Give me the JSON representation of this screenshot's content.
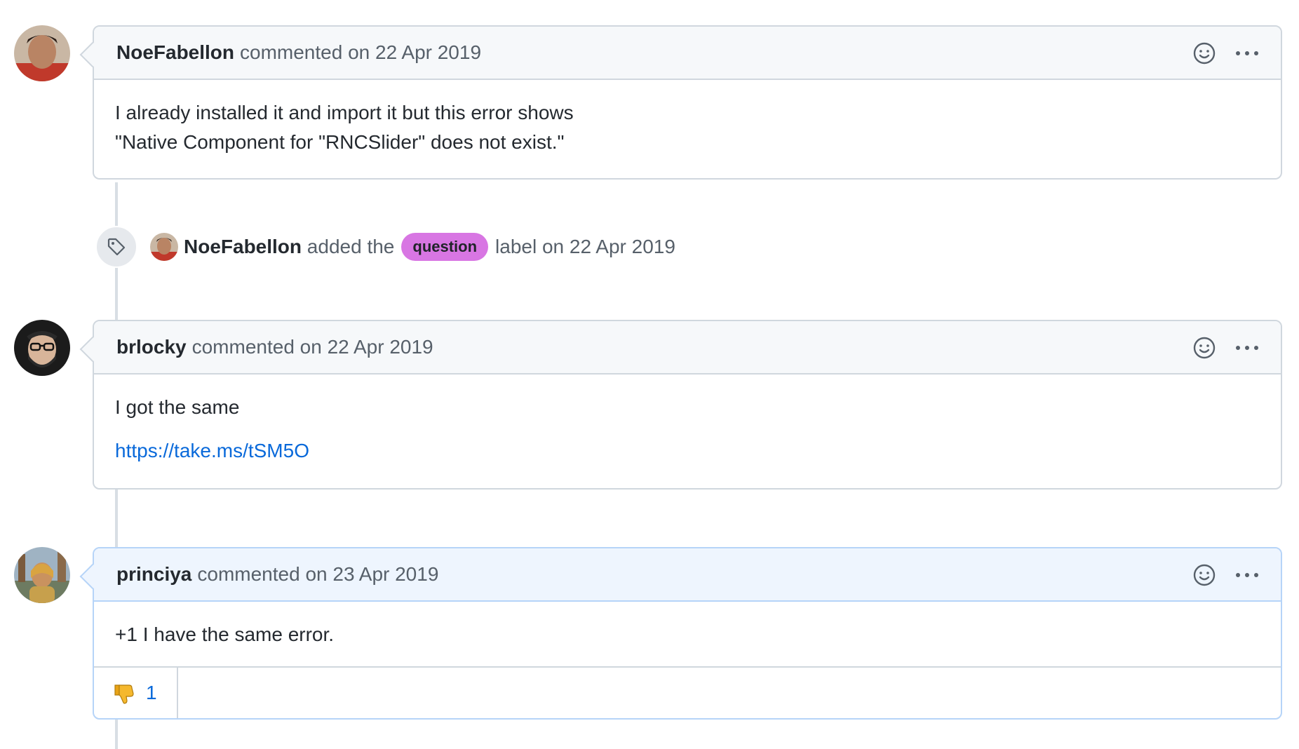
{
  "timeline": {
    "comments": [
      {
        "author": "NoeFabellon",
        "meta": "commented on 22 Apr 2019",
        "body_lines": [
          "I already installed it and import it but this error shows",
          "\"Native Component for \"RNCSlider\" does not exist.\""
        ]
      },
      {
        "author": "brlocky",
        "meta": "commented on 22 Apr 2019",
        "body_text": "I got the same",
        "body_link": "https://take.ms/tSM5O"
      },
      {
        "author": "princiya",
        "meta": "commented on 23 Apr 2019",
        "body_text": "+1 I have the same error.",
        "reactions": [
          {
            "icon": "thumbs-down-icon",
            "count": "1"
          }
        ]
      }
    ],
    "event": {
      "icon": "tag-icon",
      "actor": "NoeFabellon",
      "action": "added the",
      "label": "question",
      "suffix": "label on 22 Apr 2019"
    }
  },
  "colors": {
    "label_bg": "#d876e3",
    "link": "#0969da",
    "highlight_header": "#eef5fe",
    "header_bg": "#f6f8fa"
  }
}
